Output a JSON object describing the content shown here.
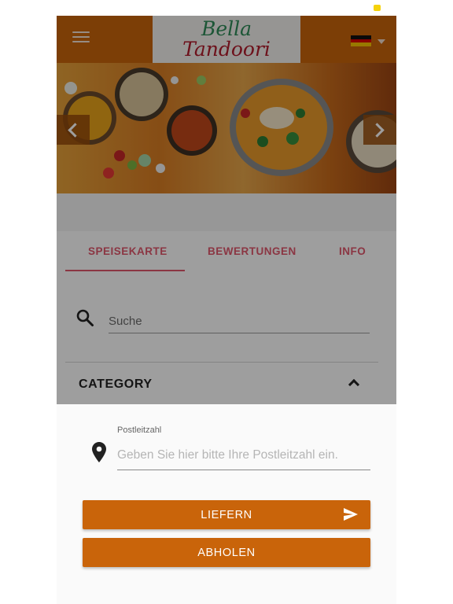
{
  "header": {
    "logo_line1": "Bella",
    "logo_line2": "Tandoori",
    "menu_icon": "hamburger-menu-icon",
    "language_flag": "german-flag-icon"
  },
  "banner": {
    "prev_icon": "chevron-left-icon",
    "next_icon": "chevron-right-icon"
  },
  "tabs": [
    {
      "label": "SPEISEKARTE",
      "active": true
    },
    {
      "label": "BEWERTUNGEN",
      "active": false
    },
    {
      "label": "INFO",
      "active": false
    }
  ],
  "search": {
    "placeholder": "Suche",
    "icon": "search-icon"
  },
  "category": {
    "title": "CATEGORY",
    "icon": "chevron-up-icon"
  },
  "delivery_sheet": {
    "zip_label": "Postleitzahl",
    "zip_placeholder": "Geben Sie hier bitte Ihre Postleitzahl ein.",
    "deliver_button": "LIEFERN",
    "pickup_button": "ABHOLEN",
    "location_icon": "location-pin-icon",
    "send_icon": "send-icon"
  },
  "colors": {
    "brand_orange": "#c9640a",
    "tab_accent": "#e0576d",
    "logo_green": "#2e8b57",
    "logo_red": "#b01c2c"
  }
}
